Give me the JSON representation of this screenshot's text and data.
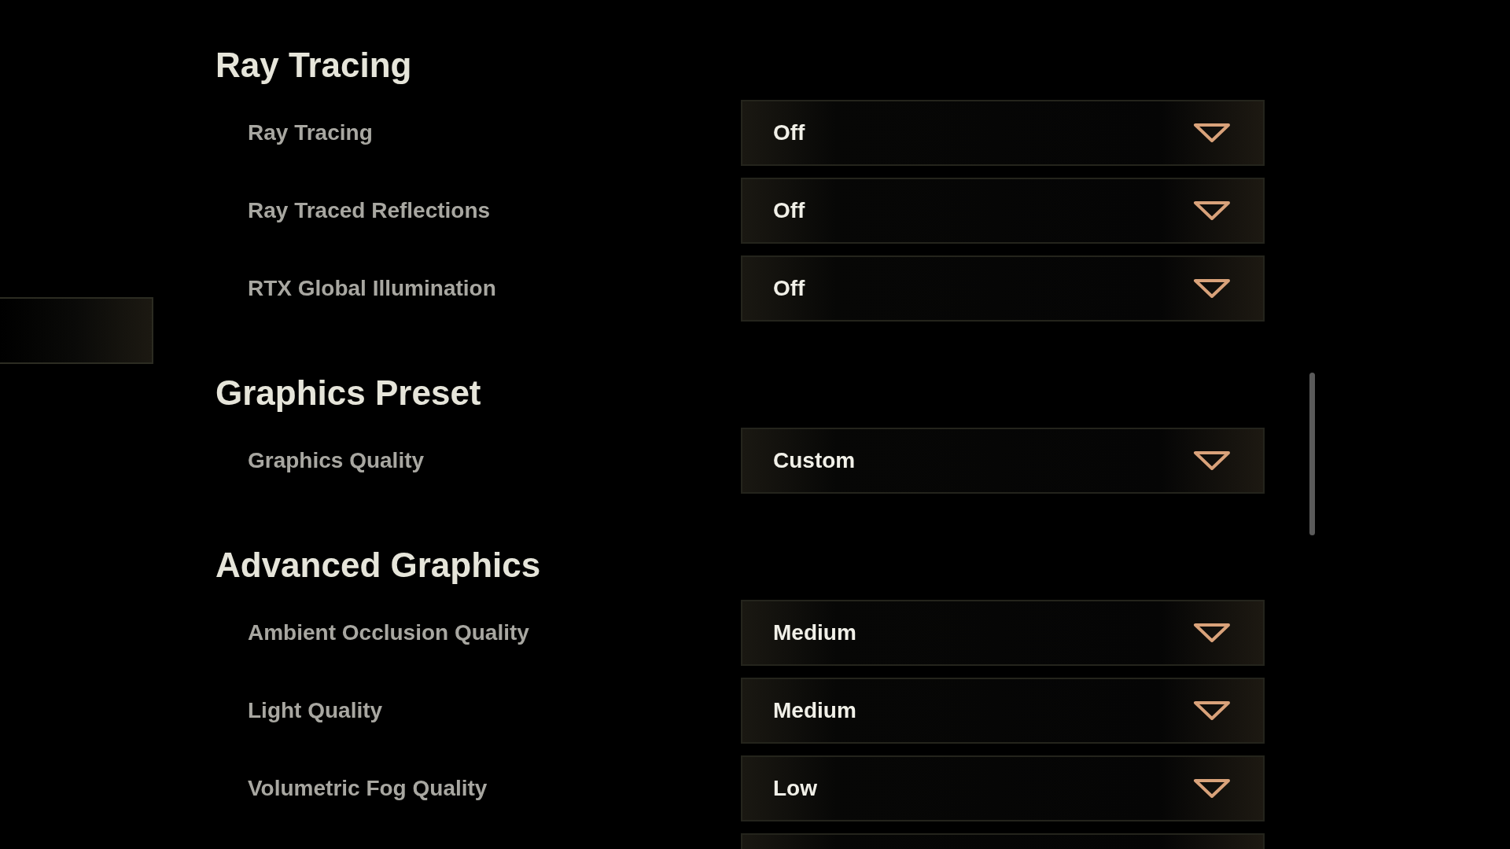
{
  "sections": [
    {
      "title": "Ray Tracing",
      "settings": [
        {
          "label": "Ray Tracing",
          "value": "Off"
        },
        {
          "label": "Ray Traced Reflections",
          "value": "Off"
        },
        {
          "label": "RTX Global Illumination",
          "value": "Off"
        }
      ]
    },
    {
      "title": "Graphics Preset",
      "settings": [
        {
          "label": "Graphics Quality",
          "value": "Custom"
        }
      ]
    },
    {
      "title": "Advanced Graphics",
      "settings": [
        {
          "label": "Ambient Occlusion Quality",
          "value": "Medium"
        },
        {
          "label": "Light Quality",
          "value": "Medium"
        },
        {
          "label": "Volumetric Fog Quality",
          "value": "Low"
        }
      ]
    }
  ]
}
